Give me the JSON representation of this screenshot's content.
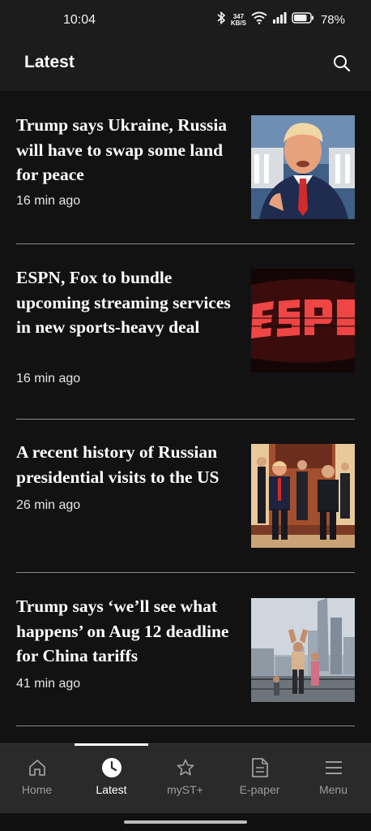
{
  "status_bar": {
    "time": "10:04",
    "net_speed_value": "347",
    "net_speed_unit": "KB/S",
    "battery": "78%"
  },
  "header": {
    "title": "Latest",
    "search_icon": "search-icon"
  },
  "articles": [
    {
      "headline": "Trump says Ukraine, Russia will have to swap some land for peace",
      "time": "16 min ago",
      "image": "trump-portrait"
    },
    {
      "headline": "ESPN, Fox to bundle upcoming streaming services in new sports-heavy deal",
      "time": "16 min ago",
      "image": "espn-logo"
    },
    {
      "headline": "A recent history of Russian presidential visits to the US",
      "time": "26 min ago",
      "image": "trump-putin-walking"
    },
    {
      "headline": "Trump says ‘we’ll see what happens’ on Aug 12 deadline for China tariffs",
      "time": "41 min ago",
      "image": "beijing-skyline"
    }
  ],
  "nav": {
    "items": [
      {
        "label": "Home",
        "icon": "home-icon"
      },
      {
        "label": "Latest",
        "icon": "clock-icon",
        "active": true
      },
      {
        "label": "myST+",
        "icon": "star-icon"
      },
      {
        "label": "E-paper",
        "icon": "document-icon"
      },
      {
        "label": "Menu",
        "icon": "menu-icon"
      }
    ]
  },
  "colors": {
    "background": "#121212",
    "header": "#1c1c1c",
    "nav_background": "#2a2a2a",
    "divider": "#8a8a8a",
    "inactive_nav": "#9c9c9c"
  }
}
